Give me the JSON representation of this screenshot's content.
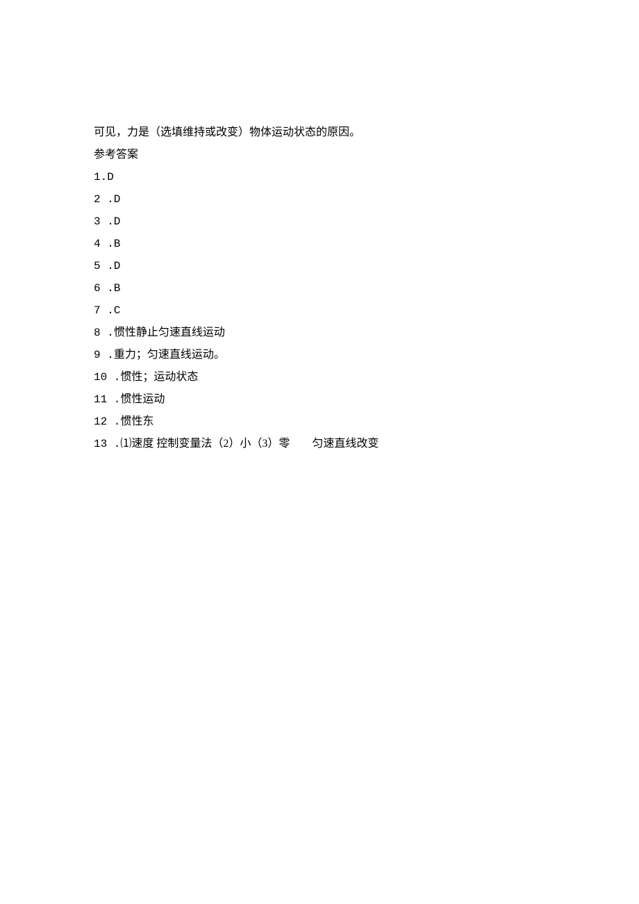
{
  "intro_line": "可见，力是（选填维持或改变）物体运动状态的原因。",
  "answers_header": "参考答案",
  "answers": [
    {
      "label": "1.D",
      "text": ""
    },
    {
      "label": "2 .D",
      "text": ""
    },
    {
      "label": "3 .D",
      "text": ""
    },
    {
      "label": "4 .B",
      "text": ""
    },
    {
      "label": "5 .D",
      "text": ""
    },
    {
      "label": "6 .B",
      "text": ""
    },
    {
      "label": "7 .C",
      "text": ""
    },
    {
      "label": "8 .",
      "text": "惯性静止匀速直线运动"
    },
    {
      "label": "9 .",
      "text": "重力；匀速直线运动。"
    },
    {
      "label": "10 .",
      "text": "惯性；运动状态"
    },
    {
      "label": "11 .",
      "text": "惯性运动"
    },
    {
      "label": "12 .",
      "text": "惯性东"
    },
    {
      "label": "13 .",
      "text": "⑴速度 控制变量法（2）小（3）零        匀速直线改变"
    }
  ]
}
